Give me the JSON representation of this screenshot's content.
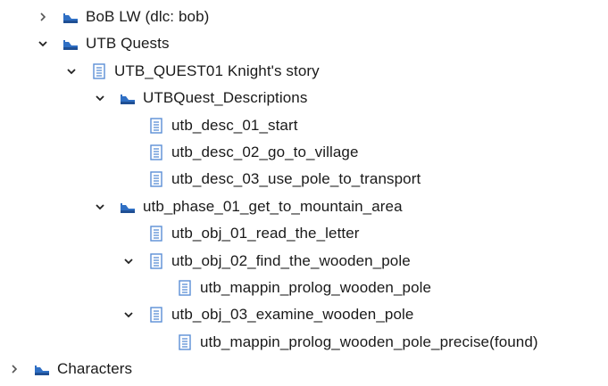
{
  "tree": {
    "nodes": [
      {
        "label": "BoB LW (dlc: bob)",
        "type": "folder",
        "state": "collapsed",
        "depth": 1
      },
      {
        "label": "UTB Quests",
        "type": "folder",
        "state": "expanded",
        "depth": 1
      },
      {
        "label": "UTB_QUEST01 Knight's story",
        "type": "file",
        "state": "expanded",
        "depth": 2
      },
      {
        "label": "UTBQuest_Descriptions",
        "type": "folder",
        "state": "expanded",
        "depth": 3
      },
      {
        "label": "utb_desc_01_start",
        "type": "file",
        "state": "leaf",
        "depth": 4
      },
      {
        "label": "utb_desc_02_go_to_village",
        "type": "file",
        "state": "leaf",
        "depth": 4
      },
      {
        "label": "utb_desc_03_use_pole_to_transport",
        "type": "file",
        "state": "leaf",
        "depth": 4
      },
      {
        "label": "utb_phase_01_get_to_mountain_area",
        "type": "folder",
        "state": "expanded",
        "depth": 3
      },
      {
        "label": "utb_obj_01_read_the_letter",
        "type": "file",
        "state": "leaf",
        "depth": 4
      },
      {
        "label": "utb_obj_02_find_the_wooden_pole",
        "type": "file",
        "state": "expanded",
        "depth": 4
      },
      {
        "label": "utb_mappin_prolog_wooden_pole",
        "type": "file",
        "state": "leaf",
        "depth": 5
      },
      {
        "label": "utb_obj_03_examine_wooden_pole",
        "type": "file",
        "state": "expanded",
        "depth": 4
      },
      {
        "label": "utb_mappin_prolog_wooden_pole_precise(found)",
        "type": "file",
        "state": "leaf",
        "depth": 5
      },
      {
        "label": "Characters",
        "type": "folder",
        "state": "collapsed",
        "depth": 0
      }
    ]
  },
  "icons": {
    "folder": "folder-icon",
    "file": "document-icon",
    "collapsed": "chevron-right-icon",
    "expanded": "chevron-down-icon"
  },
  "colors": {
    "folder_blue": "#2f6fc4",
    "folder_dark": "#1f4f94",
    "file_blue": "#5b8fd6",
    "chevron": "#555555",
    "text": "#1a1a1a"
  }
}
